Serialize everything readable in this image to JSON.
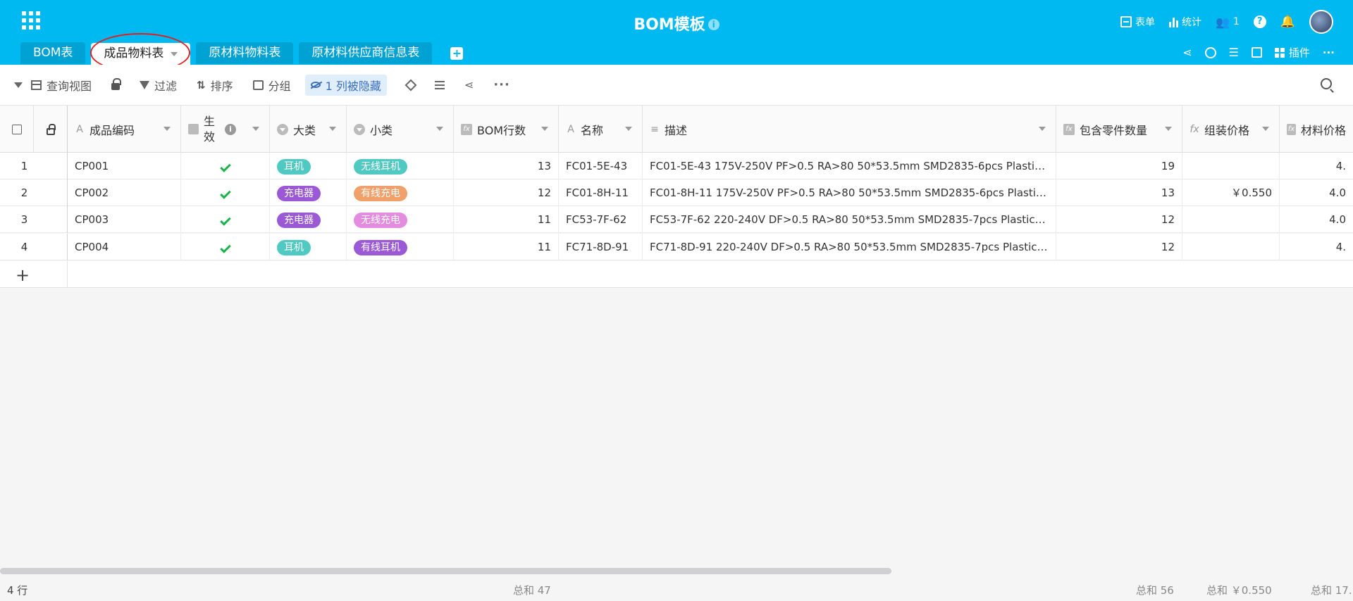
{
  "app": {
    "title": "BOM模板",
    "title_info": "i"
  },
  "header_actions": {
    "form": "表单",
    "stats": "统计",
    "members_count": "1",
    "help": "?"
  },
  "tabs": [
    {
      "label": "BOM表"
    },
    {
      "label": "成品物料表"
    },
    {
      "label": "原材料物料表"
    },
    {
      "label": "原材料供应商信息表"
    }
  ],
  "tab_add": "+",
  "tab_actions": {
    "plugins": "插件",
    "more": "···"
  },
  "toolbar": {
    "view": "查询视图",
    "filter": "过滤",
    "sort": "排序",
    "group": "分组",
    "hidden": "1 列被隐藏",
    "sort_icon": "⇅",
    "share_icon": "⋖",
    "more": "···"
  },
  "columns": [
    {
      "label": "成品编码",
      "type_icon": "A"
    },
    {
      "label": "生效",
      "type_icon": "checkbox-icon"
    },
    {
      "label": "大类",
      "type_icon": "single-select-icon"
    },
    {
      "label": "小类",
      "type_icon": "single-select-icon"
    },
    {
      "label": "BOM行数",
      "type_icon": "fx"
    },
    {
      "label": "名称",
      "type_icon": "A"
    },
    {
      "label": "描述",
      "type_icon": "≡"
    },
    {
      "label": "包含零件数量",
      "type_icon": "fx"
    },
    {
      "label": "组装价格",
      "type_icon": "fx"
    },
    {
      "label": "材料价格",
      "type_icon": "fx"
    }
  ],
  "rows": [
    {
      "idx": "1",
      "code": "CP001",
      "cat": "耳机",
      "sub": "无线耳机",
      "bom": "13",
      "name": "FC01-5E-43",
      "desc": "FC01-5E-43 175V-250V PF>0.5 RA>80  50*53.5mm  SMD2835-6pcs  Plasti…",
      "parts": "19",
      "asm": "",
      "mat": "4."
    },
    {
      "idx": "2",
      "code": "CP002",
      "cat": "充电器",
      "sub": "有线充电",
      "bom": "12",
      "name": "FC01-8H-11",
      "desc": "FC01-8H-11 175V-250V PF>0.5 RA>80  50*53.5mm  SMD2835-6pcs  Plasti…",
      "parts": "13",
      "asm": "￥0.550",
      "mat": "4.0"
    },
    {
      "idx": "3",
      "code": "CP003",
      "cat": "充电器",
      "sub": "无线充电",
      "bom": "11",
      "name": "FC53-7F-62",
      "desc": "FC53-7F-62 220-240V DF>0.5 RA>80  50*53.5mm  SMD2835-7pcs  Plastic …",
      "parts": "12",
      "asm": "",
      "mat": "4.0"
    },
    {
      "idx": "4",
      "code": "CP004",
      "cat": "耳机",
      "sub": "有线耳机",
      "bom": "11",
      "name": "FC71-8D-91",
      "desc": "FC71-8D-91 220-240V DF>0.5 RA>80  50*53.5mm  SMD2835-7pcs  Plastic…",
      "parts": "12",
      "asm": "",
      "mat": "4."
    }
  ],
  "add_row": "+",
  "footer": {
    "row_count": "4 行",
    "bom_sum": "总和 47",
    "parts_sum": "总和 56",
    "asm_sum": "总和 ￥0.550",
    "mat_sum": "总和 17."
  },
  "colors": {
    "header_bg": "#00b9f1",
    "tag_earphone": "#4fc9c2",
    "tag_charger": "#9b59d6",
    "tag_wireless_earphone": "#4fc9c2",
    "tag_wired_charge": "#f0a06a",
    "tag_wireless_charge": "#e38ce0",
    "tag_wired_earphone": "#9b59d6",
    "check": "#1bb34a"
  }
}
